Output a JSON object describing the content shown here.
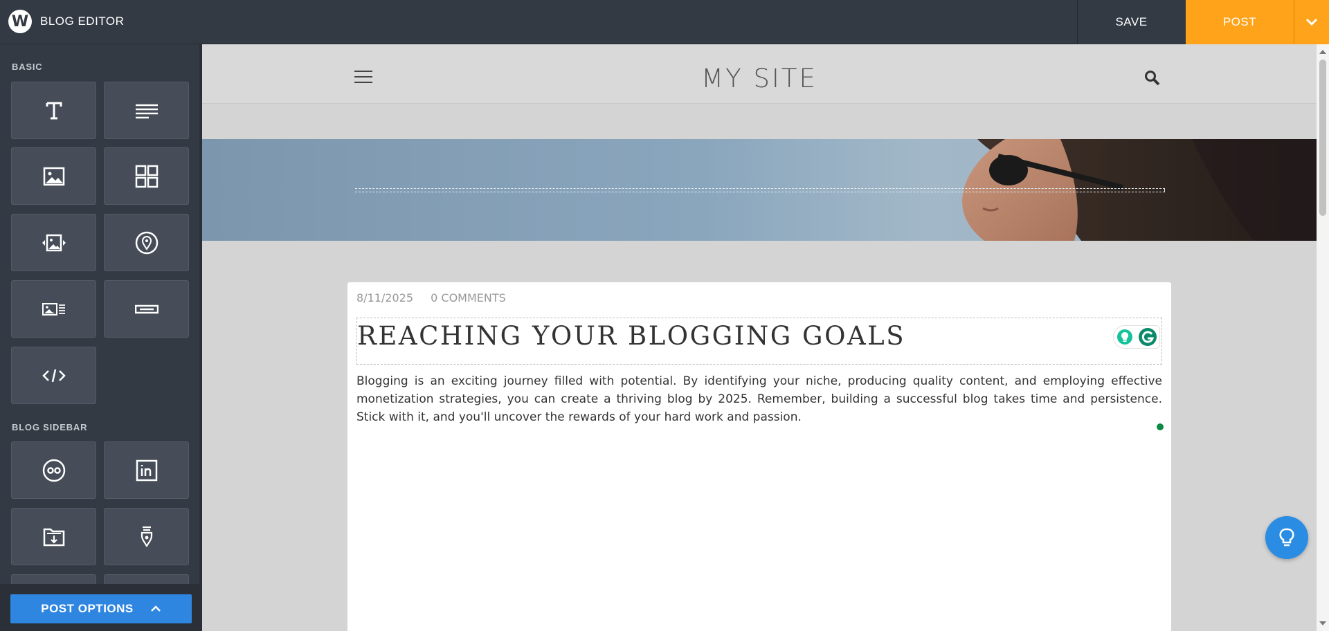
{
  "header": {
    "brand_logo_letter": "W",
    "title": "BLOG EDITOR",
    "save_label": "SAVE",
    "post_label": "POST"
  },
  "sidebar": {
    "basic_label": "BASIC",
    "basic_items": [
      {
        "icon": "title-icon",
        "name": "Title"
      },
      {
        "icon": "paragraph-icon",
        "name": "Paragraph"
      },
      {
        "icon": "image-icon",
        "name": "Image"
      },
      {
        "icon": "gallery-icon",
        "name": "Gallery"
      },
      {
        "icon": "slideshow-icon",
        "name": "Slideshow"
      },
      {
        "icon": "map-icon",
        "name": "Map"
      },
      {
        "icon": "image-text-icon",
        "name": "Image & Text"
      },
      {
        "icon": "button-icon",
        "name": "Button"
      },
      {
        "icon": "embed-code-icon",
        "name": "Embed Code"
      }
    ],
    "blog_sidebar_label": "BLOG SIDEBAR",
    "blog_sidebar_items": [
      {
        "icon": "flickr-icon",
        "name": "Flickr"
      },
      {
        "icon": "linkedin-icon",
        "name": "LinkedIn"
      },
      {
        "icon": "archives-icon",
        "name": "Archives"
      },
      {
        "icon": "author-icon",
        "name": "Author"
      }
    ],
    "post_options_label": "POST OPTIONS"
  },
  "site": {
    "title": "MY SITE"
  },
  "post": {
    "date": "8/11/2025",
    "comments": "0 COMMENTS",
    "title": "REACHING YOUR BLOGGING GOALS",
    "body": "Blogging is an exciting journey filled with potential. By identifying your niche, producing quality content, and employing effective monetization strategies, you can create a thriving blog by 2025. Remember, building a successful blog takes time and persistence. Stick with it, and you'll uncover the rewards of your hard work and passion."
  },
  "colors": {
    "topbar": "#343a44",
    "accent_post": "#ffa31a",
    "post_options": "#2f86e0",
    "tip_button": "#2a8de3",
    "grammarly_green": "#0b8a43"
  }
}
